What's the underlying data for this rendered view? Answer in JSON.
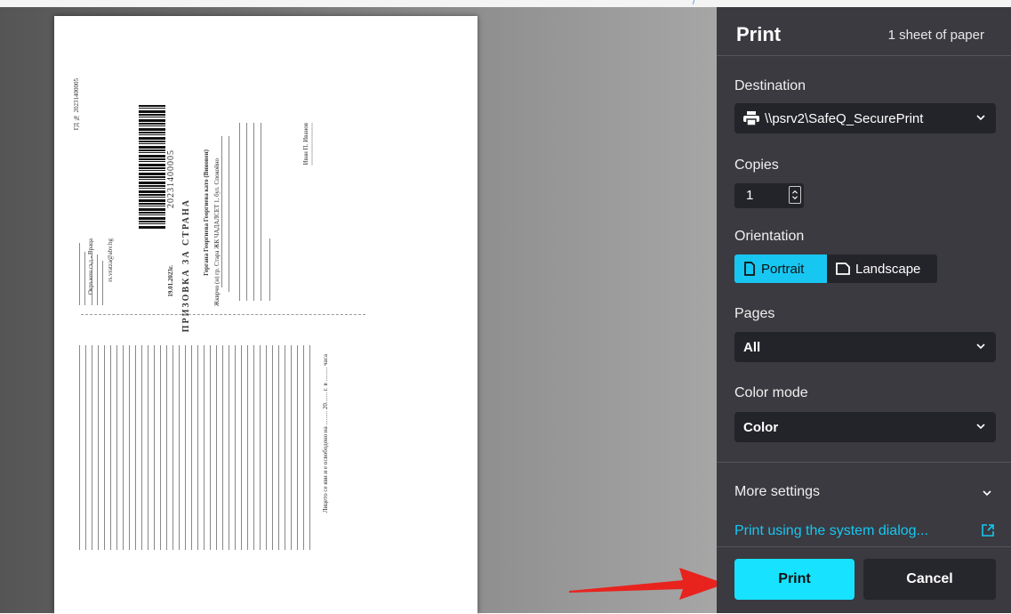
{
  "panel": {
    "title": "Print",
    "sheets": "1 sheet of paper",
    "destination": {
      "label": "Destination",
      "value": "\\\\psrv2\\SafeQ_SecurePrint"
    },
    "copies": {
      "label": "Copies",
      "value": "1"
    },
    "orientation": {
      "label": "Orientation",
      "portrait": "Portrait",
      "landscape": "Landscape",
      "selected": "Portrait"
    },
    "pages": {
      "label": "Pages",
      "value": "All"
    },
    "color_mode": {
      "label": "Color mode",
      "value": "Color"
    },
    "more_settings": "More settings",
    "system_dialog_link": "Print using the system dialog...",
    "print_button": "Print",
    "cancel_button": "Cancel"
  },
  "colors": {
    "accent": "#17c7f2",
    "print_button": "#17e2ff",
    "panel_bg": "#3a3a40",
    "arrow": "#e8231e"
  },
  "document": {
    "barcode_number": "20231400005",
    "ref_number": "ГД № 20231400005",
    "doc_title": "ПРИЗОВКА ЗА СТРАНА",
    "date": "19.01.2023г.",
    "court": "Окръжен съд - Враца",
    "email": "rs.vratza@abv.bg",
    "party": "Гергана Георгиева Георгиева като (Виновен)",
    "address": "Жкврчо (н) гр. Стара ЖК ЧАДАЛСЕТ 1, бул. Спокойно",
    "signature": "Иван П. Иванов",
    "footer": "Лицето се яви и е освободено на ......... 20....... г. в ......... часа"
  }
}
